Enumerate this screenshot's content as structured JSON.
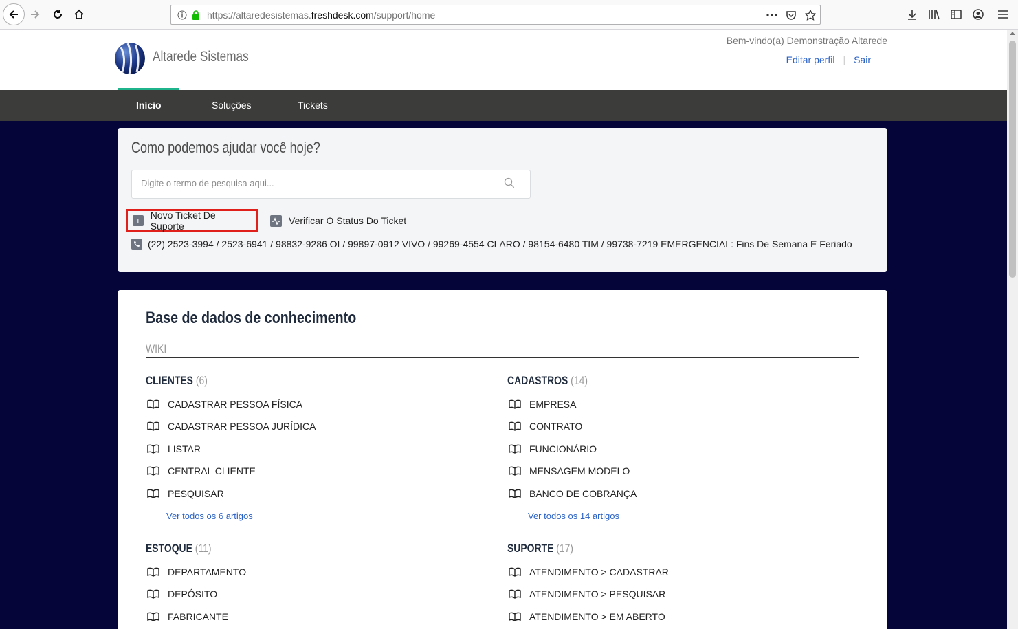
{
  "browser": {
    "url_prefix": "https://altaredesistemas.",
    "url_domain": "freshdesk.com",
    "url_path": "/support/home"
  },
  "header": {
    "brand": "Altarede Sistemas",
    "welcome": "Bem-vindo(a) Demonstração Altarede",
    "edit_profile": "Editar perfil",
    "logout": "Sair"
  },
  "nav": {
    "items": [
      "Início",
      "Soluções",
      "Tickets"
    ]
  },
  "help": {
    "title": "Como podemos ajudar você hoje?",
    "search_placeholder": "Digite o termo de pesquisa aqui...",
    "new_ticket": "Novo Ticket De Suporte",
    "check_status": "Verificar O Status Do Ticket",
    "phones": "(22) 2523-3994 / 2523-6941 / 98832-9286 OI / 99897-0912 VIVO / 99269-4554 CLARO / 98154-6480 TIM / 99738-7219 EMERGENCIAL: Fins De Semana E Feriado"
  },
  "kb": {
    "title": "Base de dados de conhecimento",
    "section": "WIKI",
    "categories": [
      {
        "name": "CLIENTES",
        "count": "(6)",
        "articles": [
          "CADASTRAR PESSOA FÍSICA",
          "CADASTRAR PESSOA JURÍDICA",
          "LISTAR",
          "CENTRAL CLIENTE",
          "PESQUISAR"
        ],
        "more": "Ver todos os 6 artigos"
      },
      {
        "name": "CADASTROS",
        "count": "(14)",
        "articles": [
          "EMPRESA",
          "CONTRATO",
          "FUNCIONÁRIO",
          "MENSAGEM MODELO",
          "BANCO DE COBRANÇA"
        ],
        "more": "Ver todos os 14 artigos"
      },
      {
        "name": "ESTOQUE",
        "count": "(11)",
        "articles": [
          "DEPARTAMENTO",
          "DEPÓSITO",
          "FABRICANTE"
        ]
      },
      {
        "name": "SUPORTE",
        "count": "(17)",
        "articles": [
          "ATENDIMENTO > CADASTRAR",
          "ATENDIMENTO > PESQUISAR",
          "ATENDIMENTO > EM ABERTO"
        ]
      }
    ]
  }
}
